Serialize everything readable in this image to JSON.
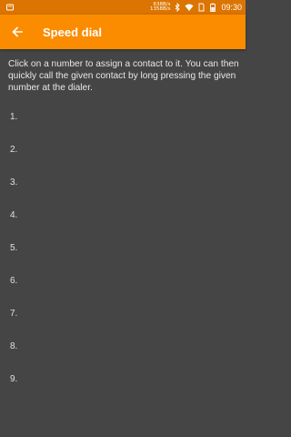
{
  "status_bar": {
    "net_speed_up": "638B/s",
    "net_speed_down": "1358B/s",
    "time": "09:30",
    "icons": [
      "notification-icon",
      "bluetooth-icon",
      "wifi-icon",
      "sim-icon",
      "battery-icon"
    ]
  },
  "app_bar": {
    "back_icon": "arrow-back-icon",
    "title": "Speed dial",
    "color": "#fb8c00"
  },
  "description": "Click on a number to assign a contact to it. You can then quickly call the given contact by long pressing the given number at the dialer.",
  "speed_dial": {
    "items": [
      {
        "label": "1."
      },
      {
        "label": "2."
      },
      {
        "label": "3."
      },
      {
        "label": "4."
      },
      {
        "label": "5."
      },
      {
        "label": "6."
      },
      {
        "label": "7."
      },
      {
        "label": "8."
      },
      {
        "label": "9."
      }
    ]
  }
}
